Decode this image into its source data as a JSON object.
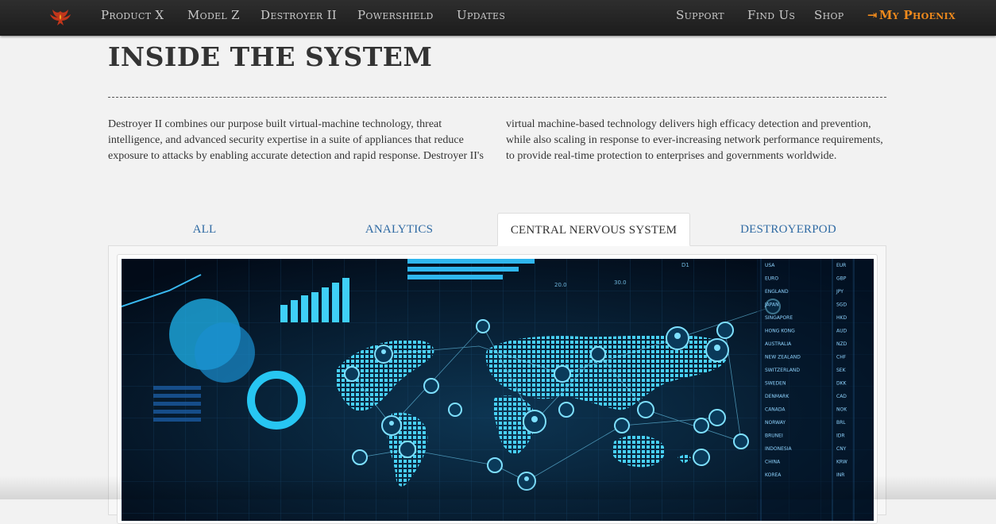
{
  "nav": {
    "left_items": [
      {
        "label": "Product X"
      },
      {
        "label": "Model Z"
      },
      {
        "label": "Destroyer II"
      },
      {
        "label": "Powershield"
      },
      {
        "label": "Updates"
      }
    ],
    "right_items": [
      {
        "label": "Support"
      },
      {
        "label": "Find Us"
      },
      {
        "label": "Shop"
      }
    ],
    "account_label": "My Phoenix",
    "accent_color": "#f08a1c"
  },
  "section": {
    "title": "INSIDE THE SYSTEM",
    "intro": "Destroyer II combines our purpose built virtual-machine technology, threat intelligence, and advanced security expertise in a suite of appliances that reduce exposure to attacks by enabling accurate detection and rapid response. Destroyer II's virtual machine-based technology delivers high efficacy detection and prevention, while also scaling in response to ever-increasing network performance requirements, to provide real-time protection to enterprises and governments worldwide."
  },
  "tabs": [
    {
      "label": "ALL",
      "active": false
    },
    {
      "label": "ANALYTICS",
      "active": false
    },
    {
      "label": "CENTRAL NERVOUS SYSTEM",
      "active": true
    },
    {
      "label": "DESTROYERPOD",
      "active": false
    }
  ],
  "image": {
    "table_rows": [
      [
        "USA",
        "EUR"
      ],
      [
        "EURO",
        "GBP"
      ],
      [
        "ENGLAND",
        "JPY"
      ],
      [
        "JAPAN",
        "SGD"
      ],
      [
        "SINGAPORE",
        "HKD"
      ],
      [
        "HONG KONG",
        "AUD"
      ],
      [
        "AUSTRALIA",
        "NZD"
      ],
      [
        "NEW ZEALAND",
        "CHF"
      ],
      [
        "SWITZERLAND",
        "SEK"
      ],
      [
        "SWEDEN",
        "DKK"
      ],
      [
        "DENMARK",
        "CAD"
      ],
      [
        "CANADA",
        "NOK"
      ],
      [
        "NORWAY",
        "BRL"
      ],
      [
        "BRUNEI",
        "IDR"
      ],
      [
        "INDONESIA",
        "CNY"
      ],
      [
        "CHINA",
        "KRW"
      ],
      [
        "KOREA",
        "INR"
      ]
    ],
    "axis_labels": [
      "20.0",
      "30.0",
      "D1"
    ]
  }
}
